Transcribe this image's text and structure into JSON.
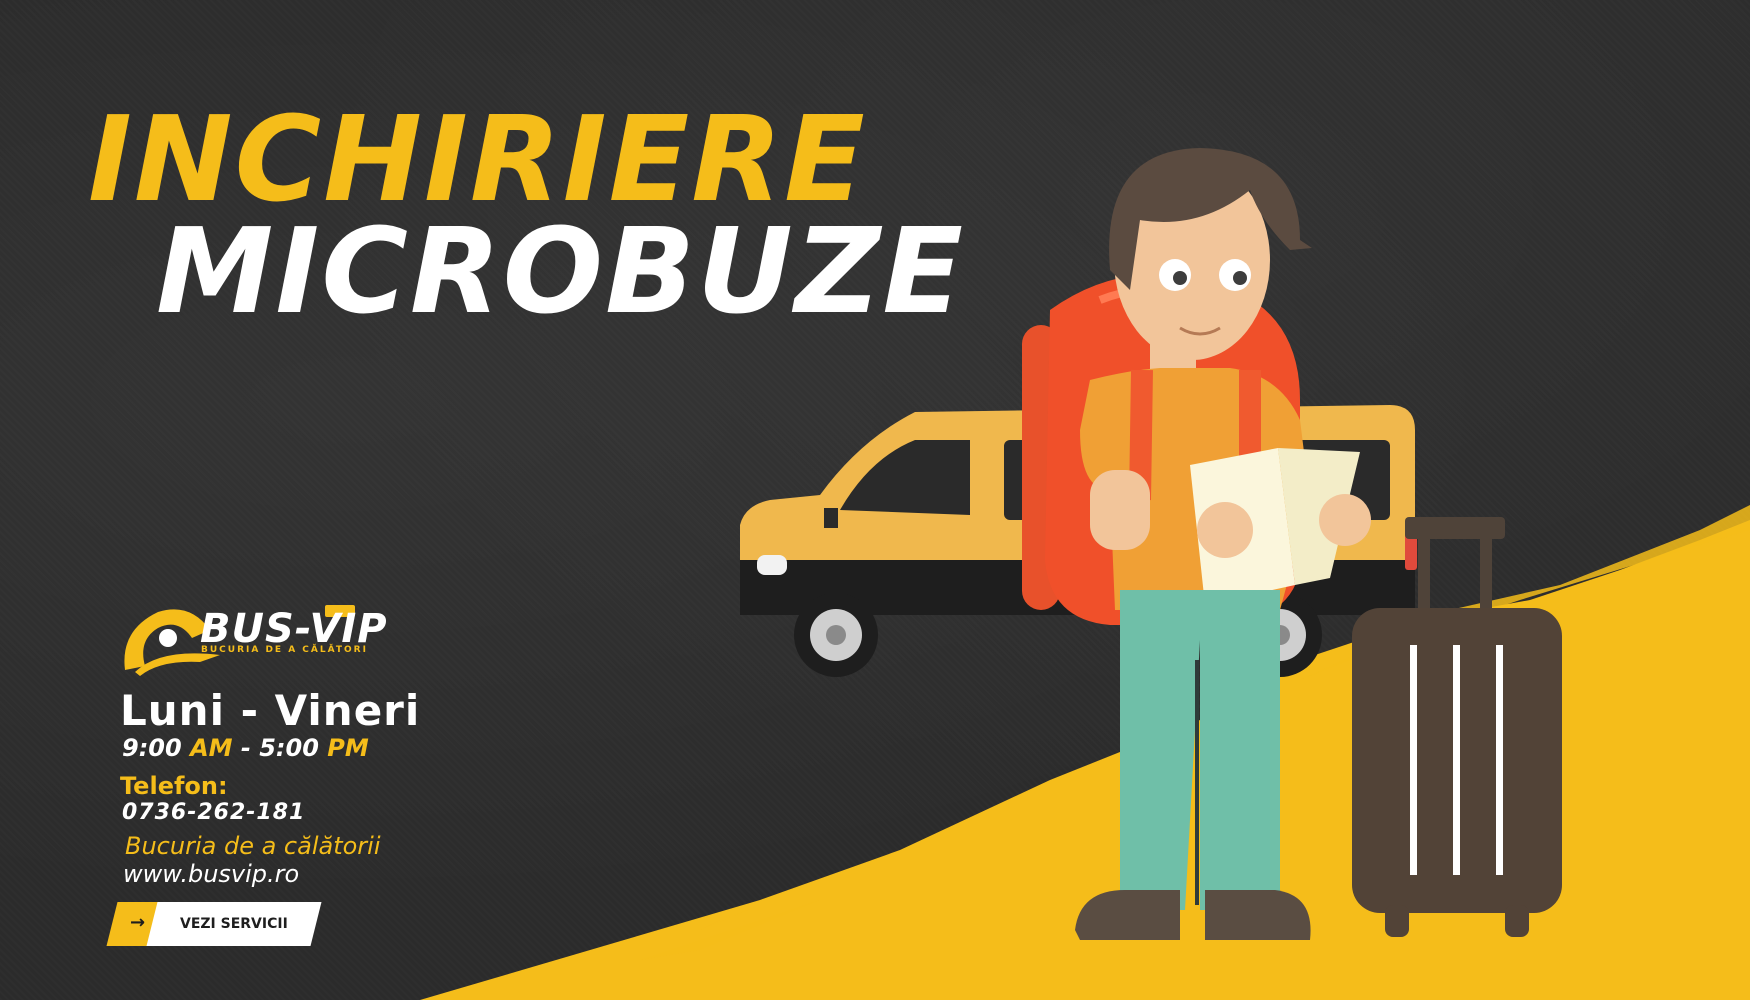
{
  "headline": {
    "line1": "INCHIRIERE",
    "line2": "MICROBUZE"
  },
  "brand": {
    "name": "BUS-VIP",
    "tagline": "BUCURIA DE A CĂLĂTORI"
  },
  "schedule": {
    "days": "Luni - Vineri",
    "start": "9:00",
    "start_suffix": "AM",
    "separator": "-",
    "end": "5:00",
    "end_suffix": "PM"
  },
  "contact": {
    "phone_label": "Telefon:",
    "phone": "0736-262-181",
    "slogan": "Bucuria de a călătorii",
    "url": "www.busvip.ro"
  },
  "cta": {
    "label": "VEZI SERVICII",
    "icon": "arrow-right-icon"
  },
  "colors": {
    "accent": "#f5bd1a",
    "background": "#2b2b2b",
    "text": "#ffffff"
  }
}
